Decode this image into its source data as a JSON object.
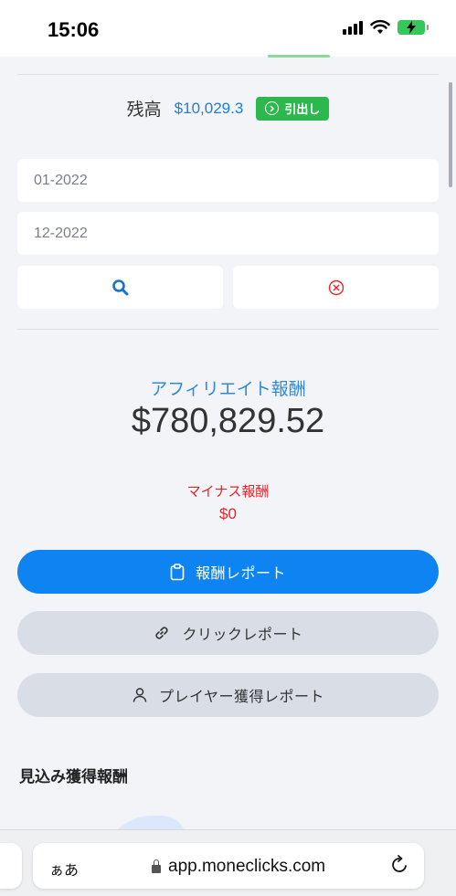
{
  "status": {
    "time": "15:06"
  },
  "balance": {
    "label": "残高",
    "value": "$10,029.3",
    "withdraw_label": "引出し"
  },
  "filters": {
    "from": "01-2022",
    "to": "12-2022"
  },
  "affiliate": {
    "label": "アフィリエイト報酬",
    "amount": "$780,829.52"
  },
  "negative": {
    "label": "マイナス報酬",
    "amount": "$0"
  },
  "buttons": {
    "reward_report": "報酬レポート",
    "click_report": "クリックレポート",
    "player_report": "プレイヤー獲得レポート"
  },
  "section": {
    "title": "見込み獲得報酬"
  },
  "browser": {
    "aa": "ぁあ",
    "url": "app.moneclicks.com"
  },
  "colors": {
    "primary": "#0e84f2",
    "success": "#2db84d",
    "danger": "#e0262c",
    "link": "#1d7fd8"
  },
  "icons": [
    "search-icon",
    "clear-icon",
    "clipboard-icon",
    "link-icon",
    "user-icon",
    "reload-icon",
    "lock-icon"
  ]
}
